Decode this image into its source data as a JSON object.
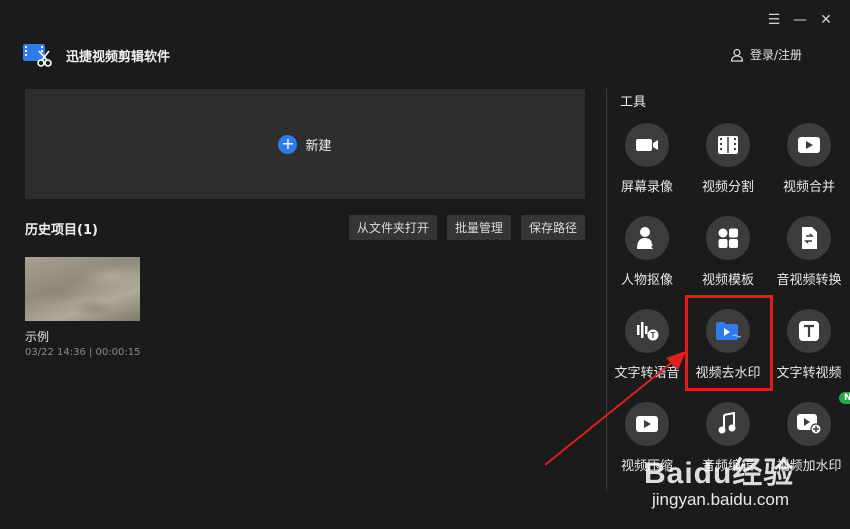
{
  "app": {
    "title": "迅捷视频剪辑软件"
  },
  "window_controls": {
    "menu": "☰",
    "minimize": "—",
    "close": "✕"
  },
  "header": {
    "login_label": "登录/注册"
  },
  "new_project": {
    "label": "新建",
    "icon": "plus-icon"
  },
  "history": {
    "title": "历史项目(1)",
    "actions": [
      "从文件夹打开",
      "批量管理",
      "保存路径"
    ],
    "items": [
      {
        "name": "示例",
        "meta": "03/22 14:36 | 00:00:15"
      }
    ]
  },
  "tools": {
    "title": "工具",
    "items": [
      {
        "label": "屏幕录像",
        "icon": "camera-icon"
      },
      {
        "label": "视频分割",
        "icon": "film-split-icon"
      },
      {
        "label": "视频合并",
        "icon": "video-merge-icon"
      },
      {
        "label": "人物抠像",
        "icon": "person-cutout-icon"
      },
      {
        "label": "视频模板",
        "icon": "template-icon"
      },
      {
        "label": "音视频转换",
        "icon": "convert-icon"
      },
      {
        "label": "文字转语音",
        "icon": "text-to-speech-icon"
      },
      {
        "label": "视频去水印",
        "icon": "remove-watermark-icon"
      },
      {
        "label": "文字转视频",
        "icon": "text-to-video-icon"
      },
      {
        "label": "视频压缩",
        "icon": "compress-icon"
      },
      {
        "label": "音频编辑",
        "icon": "music-note-icon"
      },
      {
        "label": "视频加水印",
        "icon": "add-watermark-icon",
        "badge": "NEW"
      }
    ]
  },
  "watermark": {
    "brand": "Baidu经验",
    "site": "jingyan.baidu.com"
  },
  "colors": {
    "background": "#1b1b1b",
    "accent": "#2f7bea",
    "highlight": "#e01e1e",
    "badge": "#2aa547"
  }
}
